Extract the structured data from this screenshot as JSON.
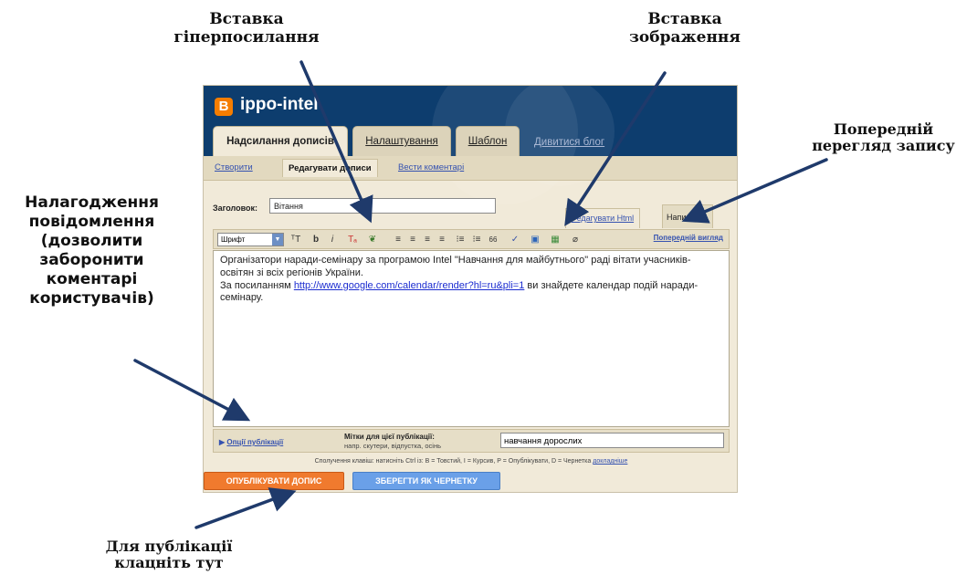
{
  "annotations": {
    "hyperlink": [
      "Вставка",
      "гіперпосилання"
    ],
    "image": [
      "Вставка",
      "зображення"
    ],
    "preview": [
      "Попередній",
      "перегляд запису"
    ],
    "options": [
      "Налагодження",
      "повідомлення",
      "(дозволити",
      "заборонити",
      "коментарі",
      "користувачів)"
    ],
    "publish": [
      "Для публікації",
      "клацніть тут"
    ]
  },
  "app": {
    "blog_name": "ippo-intel",
    "logo_letter": "B",
    "tabs": [
      "Надсилання дописів",
      "Налаштування",
      "Шаблон"
    ],
    "view_blog": "Дивитися блог",
    "subnav": [
      "Створити",
      "Редагувати дописи",
      "Вести коментарі"
    ]
  },
  "post": {
    "title_label": "Заголовок:",
    "title_value": "Вітання",
    "mode_html": "Редагувати Html",
    "mode_compose": "Написати"
  },
  "toolbar": {
    "font_label": "Шрифт",
    "buttons": [
      "ᵀT",
      "b",
      "i",
      "Tₐ",
      "❦",
      "≡",
      "≡",
      "≡",
      "≡",
      "⁝≡",
      "⁝≡",
      "66",
      "✓",
      "▣",
      "▦",
      "⌀"
    ],
    "preview_link": "Попередній вигляд"
  },
  "editor": {
    "line1": "Організатори наради-семінару за програмою Intel \"Навчання для майбутнього\" раді вітати учасників-освітян зі всіх регіонів України.",
    "line2_before": "За посиланням ",
    "link": "http://www.google.com/calendar/render?hl=ru&pli=1",
    "line2_after": " ви знайдете календар подій наради-семінару."
  },
  "options": {
    "link_label": "Опції публікації",
    "labels_title": "Мітки для цієї публікації:",
    "labels_hint": "напр. скутери, відпустка, осінь",
    "labels_value": "навчання дорослих"
  },
  "shortcuts": {
    "text": "Сполучення клавіш: натисніть Ctrl із: B = Товстий, I = Курсив, P = Опублікувати, D = Чернетка",
    "more": "докладніше"
  },
  "buttons": {
    "publish": "ОПУБЛІКУВАТИ ДОПИС",
    "draft": "ЗБЕРЕГТИ ЯК ЧЕРНЕТКУ"
  }
}
